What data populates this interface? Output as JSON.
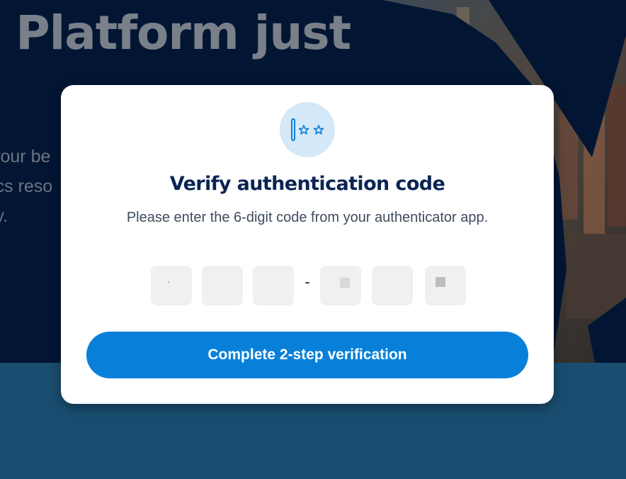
{
  "background": {
    "heading_fragment": "s Platform just",
    "text_fragments": [
      "your be",
      "ics reso",
      "ly."
    ]
  },
  "modal": {
    "icon": "password-field-icon",
    "title": "Verify authentication code",
    "subtitle": "Please enter the 6-digit code from your authenticator app.",
    "code_separator": "-",
    "code_fields": [
      "",
      "",
      "",
      "",
      "",
      ""
    ],
    "submit_label": "Complete 2-step verification"
  },
  "colors": {
    "accent": "#0880d9",
    "title": "#0a2553",
    "icon_circle": "#d4e8f7",
    "backdrop_top": "#021634",
    "backdrop_bottom": "#1a4e71"
  }
}
